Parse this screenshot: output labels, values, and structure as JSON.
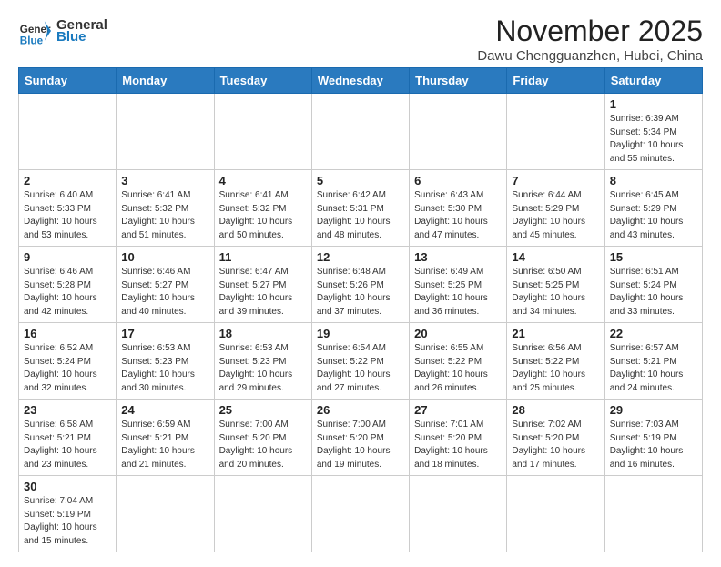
{
  "header": {
    "logo_general": "General",
    "logo_blue": "Blue",
    "month_title": "November 2025",
    "location": "Dawu Chengguanzhen, Hubei, China"
  },
  "weekdays": [
    "Sunday",
    "Monday",
    "Tuesday",
    "Wednesday",
    "Thursday",
    "Friday",
    "Saturday"
  ],
  "weeks": [
    [
      {
        "day": null
      },
      {
        "day": null
      },
      {
        "day": null
      },
      {
        "day": null
      },
      {
        "day": null
      },
      {
        "day": null
      },
      {
        "day": 1,
        "sunrise": "6:39 AM",
        "sunset": "5:34 PM",
        "daylight": "10 hours and 55 minutes."
      }
    ],
    [
      {
        "day": 2,
        "sunrise": "6:40 AM",
        "sunset": "5:33 PM",
        "daylight": "10 hours and 53 minutes."
      },
      {
        "day": 3,
        "sunrise": "6:41 AM",
        "sunset": "5:32 PM",
        "daylight": "10 hours and 51 minutes."
      },
      {
        "day": 4,
        "sunrise": "6:41 AM",
        "sunset": "5:32 PM",
        "daylight": "10 hours and 50 minutes."
      },
      {
        "day": 5,
        "sunrise": "6:42 AM",
        "sunset": "5:31 PM",
        "daylight": "10 hours and 48 minutes."
      },
      {
        "day": 6,
        "sunrise": "6:43 AM",
        "sunset": "5:30 PM",
        "daylight": "10 hours and 47 minutes."
      },
      {
        "day": 7,
        "sunrise": "6:44 AM",
        "sunset": "5:29 PM",
        "daylight": "10 hours and 45 minutes."
      },
      {
        "day": 8,
        "sunrise": "6:45 AM",
        "sunset": "5:29 PM",
        "daylight": "10 hours and 43 minutes."
      }
    ],
    [
      {
        "day": 9,
        "sunrise": "6:46 AM",
        "sunset": "5:28 PM",
        "daylight": "10 hours and 42 minutes."
      },
      {
        "day": 10,
        "sunrise": "6:46 AM",
        "sunset": "5:27 PM",
        "daylight": "10 hours and 40 minutes."
      },
      {
        "day": 11,
        "sunrise": "6:47 AM",
        "sunset": "5:27 PM",
        "daylight": "10 hours and 39 minutes."
      },
      {
        "day": 12,
        "sunrise": "6:48 AM",
        "sunset": "5:26 PM",
        "daylight": "10 hours and 37 minutes."
      },
      {
        "day": 13,
        "sunrise": "6:49 AM",
        "sunset": "5:25 PM",
        "daylight": "10 hours and 36 minutes."
      },
      {
        "day": 14,
        "sunrise": "6:50 AM",
        "sunset": "5:25 PM",
        "daylight": "10 hours and 34 minutes."
      },
      {
        "day": 15,
        "sunrise": "6:51 AM",
        "sunset": "5:24 PM",
        "daylight": "10 hours and 33 minutes."
      }
    ],
    [
      {
        "day": 16,
        "sunrise": "6:52 AM",
        "sunset": "5:24 PM",
        "daylight": "10 hours and 32 minutes."
      },
      {
        "day": 17,
        "sunrise": "6:53 AM",
        "sunset": "5:23 PM",
        "daylight": "10 hours and 30 minutes."
      },
      {
        "day": 18,
        "sunrise": "6:53 AM",
        "sunset": "5:23 PM",
        "daylight": "10 hours and 29 minutes."
      },
      {
        "day": 19,
        "sunrise": "6:54 AM",
        "sunset": "5:22 PM",
        "daylight": "10 hours and 27 minutes."
      },
      {
        "day": 20,
        "sunrise": "6:55 AM",
        "sunset": "5:22 PM",
        "daylight": "10 hours and 26 minutes."
      },
      {
        "day": 21,
        "sunrise": "6:56 AM",
        "sunset": "5:22 PM",
        "daylight": "10 hours and 25 minutes."
      },
      {
        "day": 22,
        "sunrise": "6:57 AM",
        "sunset": "5:21 PM",
        "daylight": "10 hours and 24 minutes."
      }
    ],
    [
      {
        "day": 23,
        "sunrise": "6:58 AM",
        "sunset": "5:21 PM",
        "daylight": "10 hours and 23 minutes."
      },
      {
        "day": 24,
        "sunrise": "6:59 AM",
        "sunset": "5:21 PM",
        "daylight": "10 hours and 21 minutes."
      },
      {
        "day": 25,
        "sunrise": "7:00 AM",
        "sunset": "5:20 PM",
        "daylight": "10 hours and 20 minutes."
      },
      {
        "day": 26,
        "sunrise": "7:00 AM",
        "sunset": "5:20 PM",
        "daylight": "10 hours and 19 minutes."
      },
      {
        "day": 27,
        "sunrise": "7:01 AM",
        "sunset": "5:20 PM",
        "daylight": "10 hours and 18 minutes."
      },
      {
        "day": 28,
        "sunrise": "7:02 AM",
        "sunset": "5:20 PM",
        "daylight": "10 hours and 17 minutes."
      },
      {
        "day": 29,
        "sunrise": "7:03 AM",
        "sunset": "5:19 PM",
        "daylight": "10 hours and 16 minutes."
      }
    ],
    [
      {
        "day": 30,
        "sunrise": "7:04 AM",
        "sunset": "5:19 PM",
        "daylight": "10 hours and 15 minutes."
      },
      {
        "day": null
      },
      {
        "day": null
      },
      {
        "day": null
      },
      {
        "day": null
      },
      {
        "day": null
      },
      {
        "day": null
      }
    ]
  ]
}
